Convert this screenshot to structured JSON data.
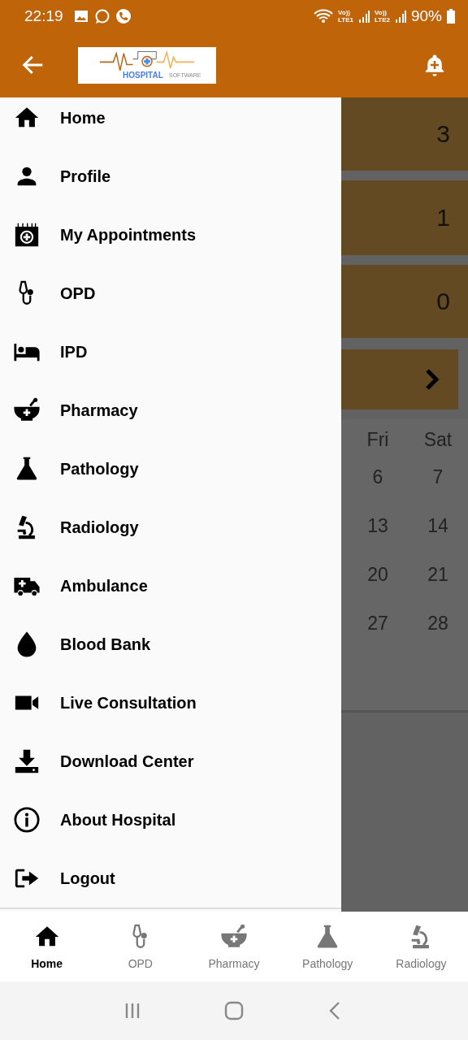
{
  "status_bar": {
    "time": "22:19",
    "sims": [
      {
        "volte": "Vo))",
        "label": "LTE1"
      },
      {
        "volte": "Vo))",
        "label": "LTE2"
      }
    ],
    "battery": "90%"
  },
  "app_bar": {
    "logo": {
      "title": "HOSPITAL",
      "subtitle": "SOFTWARE"
    }
  },
  "drawer": {
    "items": [
      {
        "kind": "home",
        "label": "Home"
      },
      {
        "kind": "person",
        "label": "Profile"
      },
      {
        "kind": "calendar",
        "label": "My Appointments"
      },
      {
        "kind": "stethoscope",
        "label": "OPD"
      },
      {
        "kind": "bed",
        "label": "IPD"
      },
      {
        "kind": "mortar",
        "label": "Pharmacy"
      },
      {
        "kind": "flask",
        "label": "Pathology"
      },
      {
        "kind": "microscope",
        "label": "Radiology"
      },
      {
        "kind": "ambulance",
        "label": "Ambulance"
      },
      {
        "kind": "drop",
        "label": "Blood Bank"
      },
      {
        "kind": "video",
        "label": "Live Consultation"
      },
      {
        "kind": "download",
        "label": "Download Center"
      },
      {
        "kind": "info",
        "label": "About Hospital"
      },
      {
        "kind": "logout",
        "label": "Logout"
      }
    ]
  },
  "background": {
    "counts": [
      "3",
      "1",
      "0"
    ],
    "calendar": {
      "days": [
        "Fri",
        "Sat"
      ],
      "weeks": [
        [
          "6",
          "7"
        ],
        [
          "13",
          "14"
        ],
        [
          "20",
          "21"
        ],
        [
          "27",
          "28"
        ]
      ]
    }
  },
  "bottom_nav": [
    {
      "kind": "home",
      "label": "Home",
      "selected": true
    },
    {
      "kind": "stethoscope",
      "label": "OPD",
      "selected": false
    },
    {
      "kind": "mortar",
      "label": "Pharmacy",
      "selected": false
    },
    {
      "kind": "flask",
      "label": "Pathology",
      "selected": false
    },
    {
      "kind": "microscope",
      "label": "Radiology",
      "selected": false
    }
  ]
}
